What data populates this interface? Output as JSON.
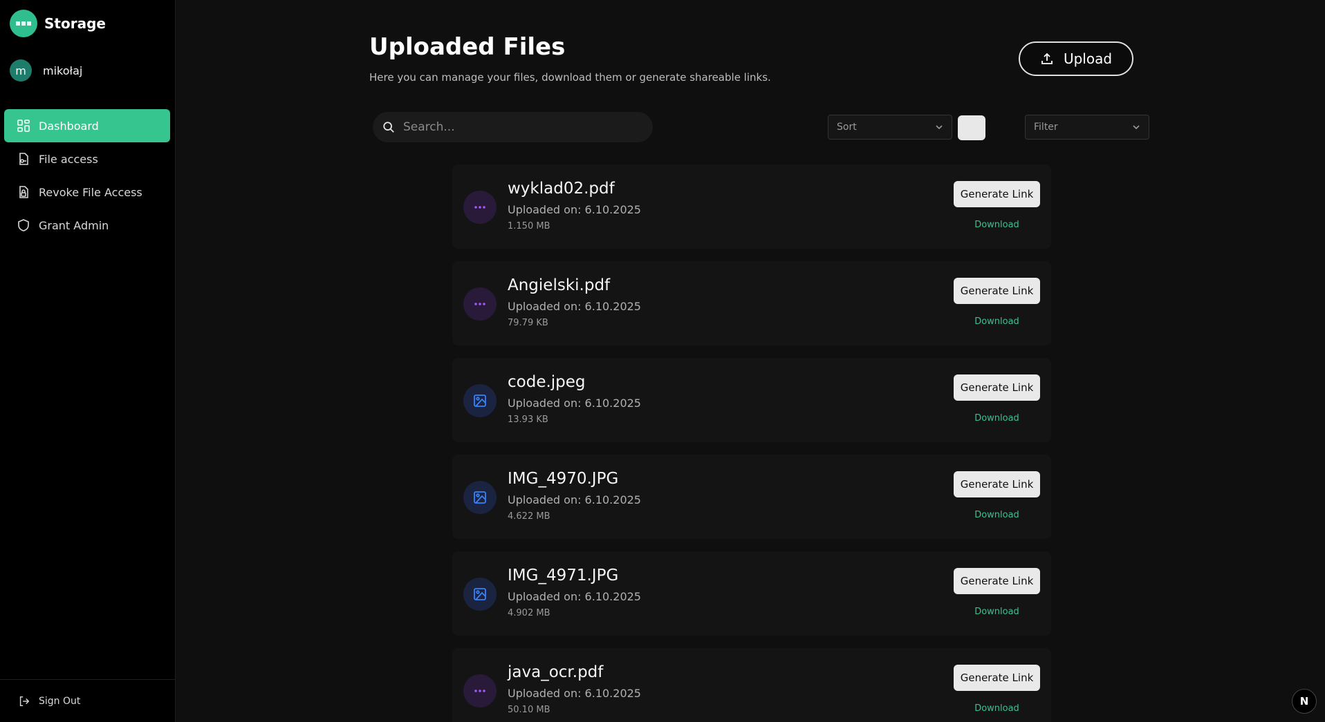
{
  "brand": {
    "name": "Storage"
  },
  "user": {
    "initial": "m",
    "name": "mikołaj"
  },
  "sidebar": {
    "items": [
      {
        "label": "Dashboard",
        "icon": "dashboard-icon",
        "active": true
      },
      {
        "label": "File access",
        "icon": "file-key-icon"
      },
      {
        "label": "Revoke File Access",
        "icon": "file-lock-icon"
      },
      {
        "label": "Grant Admin",
        "icon": "shield-icon"
      }
    ],
    "signout_label": "Sign Out"
  },
  "header": {
    "title": "Uploaded Files",
    "subtitle": "Here you can manage your files, download them or generate shareable links.",
    "upload_label": "Upload"
  },
  "toolbar": {
    "search_placeholder": "Search...",
    "sort_label": "Sort",
    "filter_label": "Filter"
  },
  "files": [
    {
      "name": "wyklad02.pdf",
      "date": "Uploaded on: 6.10.2025",
      "size": "1.150 MB",
      "type": "pdf"
    },
    {
      "name": "Angielski.pdf",
      "date": "Uploaded on: 6.10.2025",
      "size": "79.79 KB",
      "type": "pdf"
    },
    {
      "name": "code.jpeg",
      "date": "Uploaded on: 6.10.2025",
      "size": "13.93 KB",
      "type": "image"
    },
    {
      "name": "IMG_4970.JPG",
      "date": "Uploaded on: 6.10.2025",
      "size": "4.622 MB",
      "type": "image"
    },
    {
      "name": "IMG_4971.JPG",
      "date": "Uploaded on: 6.10.2025",
      "size": "4.902 MB",
      "type": "image"
    },
    {
      "name": "java_ocr.pdf",
      "date": "Uploaded on: 6.10.2025",
      "size": "50.10 MB",
      "type": "pdf"
    }
  ],
  "actions": {
    "generate_label": "Generate Link",
    "download_label": "Download"
  },
  "fab": {
    "label": "N"
  },
  "colors": {
    "accent": "#36c48f",
    "pdf": "#a855f7",
    "image": "#3b82f6"
  }
}
